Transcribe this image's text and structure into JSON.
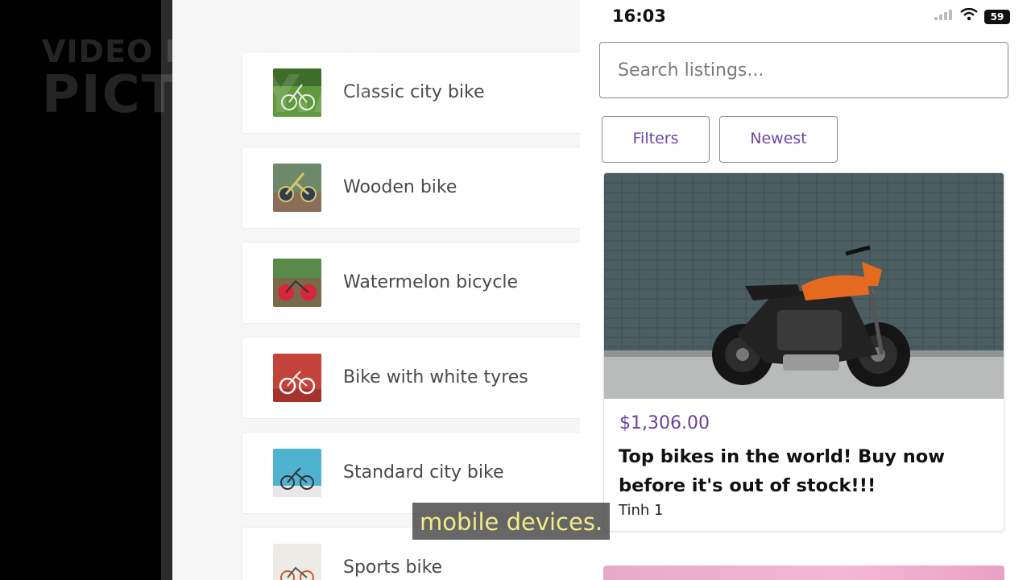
{
  "watermark": {
    "line1": "VIDEO MADE WITH",
    "line2": "PICTORY.AI"
  },
  "desktop_listings": [
    {
      "label": "Classic city bike"
    },
    {
      "label": "Wooden bike"
    },
    {
      "label": "Watermelon bicycle"
    },
    {
      "label": "Bike with white tyres"
    },
    {
      "label": "Standard city bike"
    },
    {
      "label": "Sports bike"
    }
  ],
  "phone": {
    "status": {
      "time": "16:03",
      "battery": "59"
    },
    "search": {
      "placeholder": "Search listings..."
    },
    "filters_label": "Filters",
    "sort_label": "Newest",
    "card": {
      "price": "$1,306.00",
      "title": "Top bikes in the world! Buy now before it's out of stock!!!",
      "location": "Tinh 1"
    }
  },
  "caption": "mobile devices.",
  "colors": {
    "accent": "#6b3fa0",
    "caption_text": "#f1ec86"
  }
}
